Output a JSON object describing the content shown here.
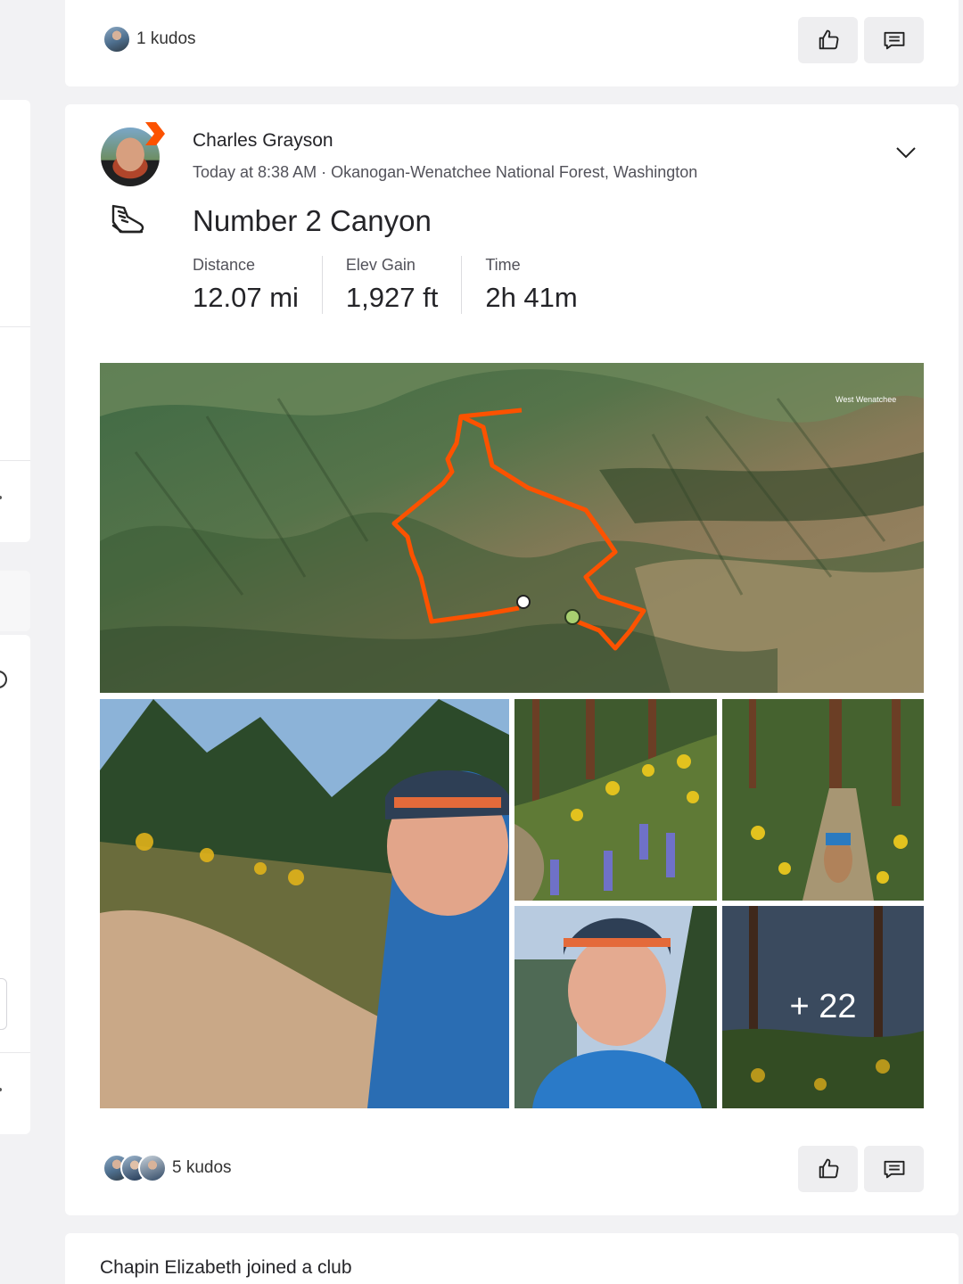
{
  "top_post": {
    "kudos_text": "1 kudos"
  },
  "activity": {
    "author": "Charles Grayson",
    "meta": "Today at 8:38 AM · Okanogan-Wenatchee National Forest, Washington",
    "title": "Number 2 Canyon",
    "sport_icon": "run-shoe-icon",
    "stats": [
      {
        "label": "Distance",
        "value": "12.07 mi"
      },
      {
        "label": "Elev Gain",
        "value": "1,927 ft"
      },
      {
        "label": "Time",
        "value": "2h 41m"
      }
    ],
    "map": {
      "place_label": "West Wenatchee",
      "route_color": "#fc5200"
    },
    "photos_more": "+ 22",
    "kudos_text": "5 kudos"
  },
  "next_post": {
    "actor": "Chapin Elizabeth",
    "action": "joined a club"
  },
  "colors": {
    "accent": "#fc5200",
    "button_bg": "#eeeef0",
    "page_bg": "#f2f2f4"
  }
}
